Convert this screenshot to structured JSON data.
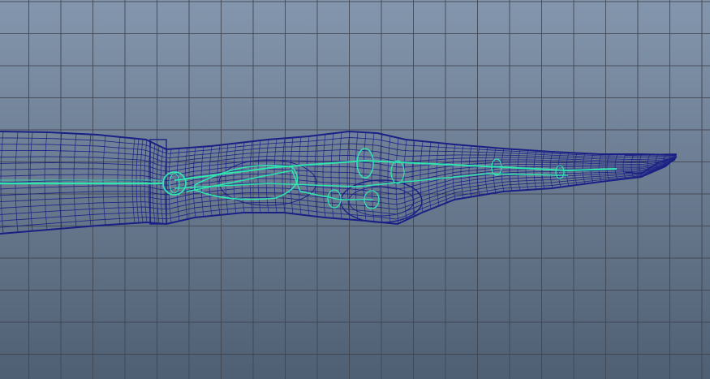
{
  "viewport": {
    "panel": "modeling-viewport",
    "view": "side-orthographic",
    "display_mode": "wireframe",
    "grid": true,
    "colors": {
      "background_top": "#8496ad",
      "background_bottom": "#4f5f73",
      "grid_line": "#3f4450",
      "wireframe": "#1a1f85",
      "rig": "#2ee6b0"
    }
  },
  "scene": {
    "mesh": "arm-hand-pointing-right",
    "rig_visible": true
  }
}
